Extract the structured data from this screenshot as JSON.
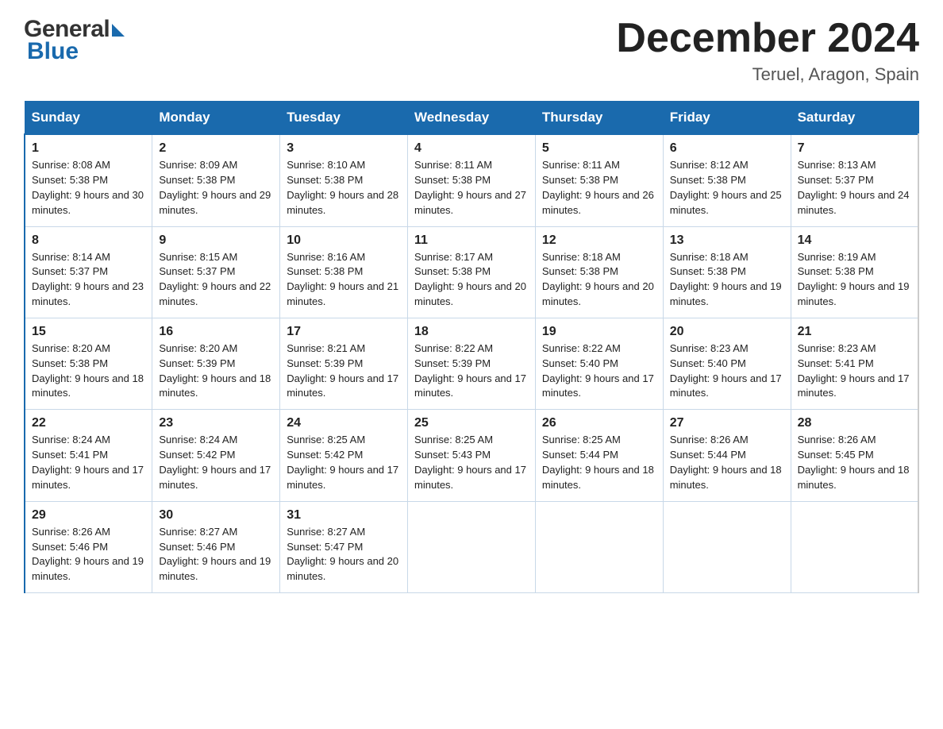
{
  "header": {
    "logo_general": "General",
    "logo_blue": "Blue",
    "month_title": "December 2024",
    "location": "Teruel, Aragon, Spain"
  },
  "days_of_week": [
    "Sunday",
    "Monday",
    "Tuesday",
    "Wednesday",
    "Thursday",
    "Friday",
    "Saturday"
  ],
  "weeks": [
    [
      {
        "day": "1",
        "sunrise": "8:08 AM",
        "sunset": "5:38 PM",
        "daylight": "9 hours and 30 minutes."
      },
      {
        "day": "2",
        "sunrise": "8:09 AM",
        "sunset": "5:38 PM",
        "daylight": "9 hours and 29 minutes."
      },
      {
        "day": "3",
        "sunrise": "8:10 AM",
        "sunset": "5:38 PM",
        "daylight": "9 hours and 28 minutes."
      },
      {
        "day": "4",
        "sunrise": "8:11 AM",
        "sunset": "5:38 PM",
        "daylight": "9 hours and 27 minutes."
      },
      {
        "day": "5",
        "sunrise": "8:11 AM",
        "sunset": "5:38 PM",
        "daylight": "9 hours and 26 minutes."
      },
      {
        "day": "6",
        "sunrise": "8:12 AM",
        "sunset": "5:38 PM",
        "daylight": "9 hours and 25 minutes."
      },
      {
        "day": "7",
        "sunrise": "8:13 AM",
        "sunset": "5:37 PM",
        "daylight": "9 hours and 24 minutes."
      }
    ],
    [
      {
        "day": "8",
        "sunrise": "8:14 AM",
        "sunset": "5:37 PM",
        "daylight": "9 hours and 23 minutes."
      },
      {
        "day": "9",
        "sunrise": "8:15 AM",
        "sunset": "5:37 PM",
        "daylight": "9 hours and 22 minutes."
      },
      {
        "day": "10",
        "sunrise": "8:16 AM",
        "sunset": "5:38 PM",
        "daylight": "9 hours and 21 minutes."
      },
      {
        "day": "11",
        "sunrise": "8:17 AM",
        "sunset": "5:38 PM",
        "daylight": "9 hours and 20 minutes."
      },
      {
        "day": "12",
        "sunrise": "8:18 AM",
        "sunset": "5:38 PM",
        "daylight": "9 hours and 20 minutes."
      },
      {
        "day": "13",
        "sunrise": "8:18 AM",
        "sunset": "5:38 PM",
        "daylight": "9 hours and 19 minutes."
      },
      {
        "day": "14",
        "sunrise": "8:19 AM",
        "sunset": "5:38 PM",
        "daylight": "9 hours and 19 minutes."
      }
    ],
    [
      {
        "day": "15",
        "sunrise": "8:20 AM",
        "sunset": "5:38 PM",
        "daylight": "9 hours and 18 minutes."
      },
      {
        "day": "16",
        "sunrise": "8:20 AM",
        "sunset": "5:39 PM",
        "daylight": "9 hours and 18 minutes."
      },
      {
        "day": "17",
        "sunrise": "8:21 AM",
        "sunset": "5:39 PM",
        "daylight": "9 hours and 17 minutes."
      },
      {
        "day": "18",
        "sunrise": "8:22 AM",
        "sunset": "5:39 PM",
        "daylight": "9 hours and 17 minutes."
      },
      {
        "day": "19",
        "sunrise": "8:22 AM",
        "sunset": "5:40 PM",
        "daylight": "9 hours and 17 minutes."
      },
      {
        "day": "20",
        "sunrise": "8:23 AM",
        "sunset": "5:40 PM",
        "daylight": "9 hours and 17 minutes."
      },
      {
        "day": "21",
        "sunrise": "8:23 AM",
        "sunset": "5:41 PM",
        "daylight": "9 hours and 17 minutes."
      }
    ],
    [
      {
        "day": "22",
        "sunrise": "8:24 AM",
        "sunset": "5:41 PM",
        "daylight": "9 hours and 17 minutes."
      },
      {
        "day": "23",
        "sunrise": "8:24 AM",
        "sunset": "5:42 PM",
        "daylight": "9 hours and 17 minutes."
      },
      {
        "day": "24",
        "sunrise": "8:25 AM",
        "sunset": "5:42 PM",
        "daylight": "9 hours and 17 minutes."
      },
      {
        "day": "25",
        "sunrise": "8:25 AM",
        "sunset": "5:43 PM",
        "daylight": "9 hours and 17 minutes."
      },
      {
        "day": "26",
        "sunrise": "8:25 AM",
        "sunset": "5:44 PM",
        "daylight": "9 hours and 18 minutes."
      },
      {
        "day": "27",
        "sunrise": "8:26 AM",
        "sunset": "5:44 PM",
        "daylight": "9 hours and 18 minutes."
      },
      {
        "day": "28",
        "sunrise": "8:26 AM",
        "sunset": "5:45 PM",
        "daylight": "9 hours and 18 minutes."
      }
    ],
    [
      {
        "day": "29",
        "sunrise": "8:26 AM",
        "sunset": "5:46 PM",
        "daylight": "9 hours and 19 minutes."
      },
      {
        "day": "30",
        "sunrise": "8:27 AM",
        "sunset": "5:46 PM",
        "daylight": "9 hours and 19 minutes."
      },
      {
        "day": "31",
        "sunrise": "8:27 AM",
        "sunset": "5:47 PM",
        "daylight": "9 hours and 20 minutes."
      },
      null,
      null,
      null,
      null
    ]
  ],
  "labels": {
    "sunrise_prefix": "Sunrise: ",
    "sunset_prefix": "Sunset: ",
    "daylight_prefix": "Daylight: "
  }
}
